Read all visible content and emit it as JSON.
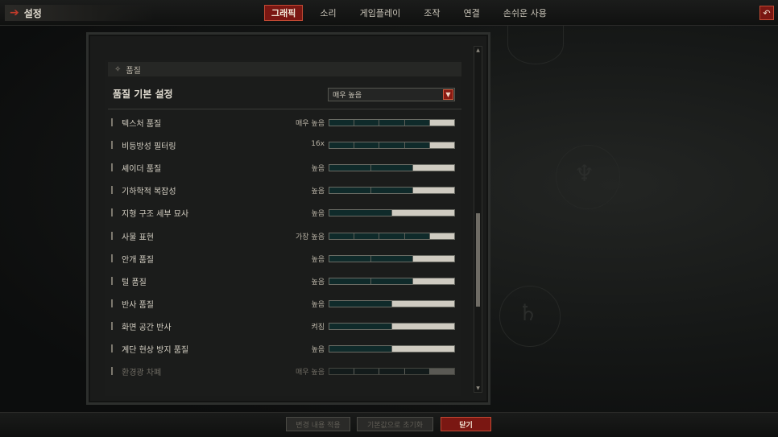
{
  "window": {
    "title": "설정"
  },
  "tabs": [
    {
      "label": "그래픽",
      "active": true
    },
    {
      "label": "소리",
      "active": false
    },
    {
      "label": "게임플레이",
      "active": false
    },
    {
      "label": "조작",
      "active": false
    },
    {
      "label": "연결",
      "active": false
    },
    {
      "label": "손쉬운 사용",
      "active": false
    }
  ],
  "section": {
    "title": "품질"
  },
  "preset": {
    "label": "품질 기본 설정",
    "value": "매우 높음"
  },
  "settings": [
    {
      "label": "텍스처 품질",
      "value": "매우 높음",
      "level": 5,
      "levels": 5
    },
    {
      "label": "비등방성 필터링",
      "value": "16x",
      "level": 5,
      "levels": 5
    },
    {
      "label": "셰이더 품질",
      "value": "높음",
      "level": 3,
      "levels": 3
    },
    {
      "label": "기하학적 복잡성",
      "value": "높음",
      "level": 3,
      "levels": 3
    },
    {
      "label": "지형 구조 세부 묘사",
      "value": "높음",
      "level": 2,
      "levels": 2
    },
    {
      "label": "사물 표현",
      "value": "가장 높음",
      "level": 5,
      "levels": 5
    },
    {
      "label": "안개 품질",
      "value": "높음",
      "level": 3,
      "levels": 3
    },
    {
      "label": "털 품질",
      "value": "높음",
      "level": 3,
      "levels": 3
    },
    {
      "label": "반사 품질",
      "value": "높음",
      "level": 2,
      "levels": 2
    },
    {
      "label": "화면 공간 반사",
      "value": "켜짐",
      "level": 2,
      "levels": 2
    },
    {
      "label": "계단 현상 방지 품질",
      "value": "높음",
      "level": 2,
      "levels": 2
    },
    {
      "label": "환경광 차폐",
      "value": "매우 높음",
      "level": 5,
      "levels": 5,
      "dim": true
    }
  ],
  "footer": {
    "apply_label": "변경 내용 적용",
    "reset_label": "기본값으로 초기화",
    "close_label": "닫기"
  },
  "colors": {
    "accent": "#7a1712",
    "accent_border": "#c24a34",
    "bar_bg": "#0f2a2a",
    "bar_fill": "#cfcbc1"
  }
}
